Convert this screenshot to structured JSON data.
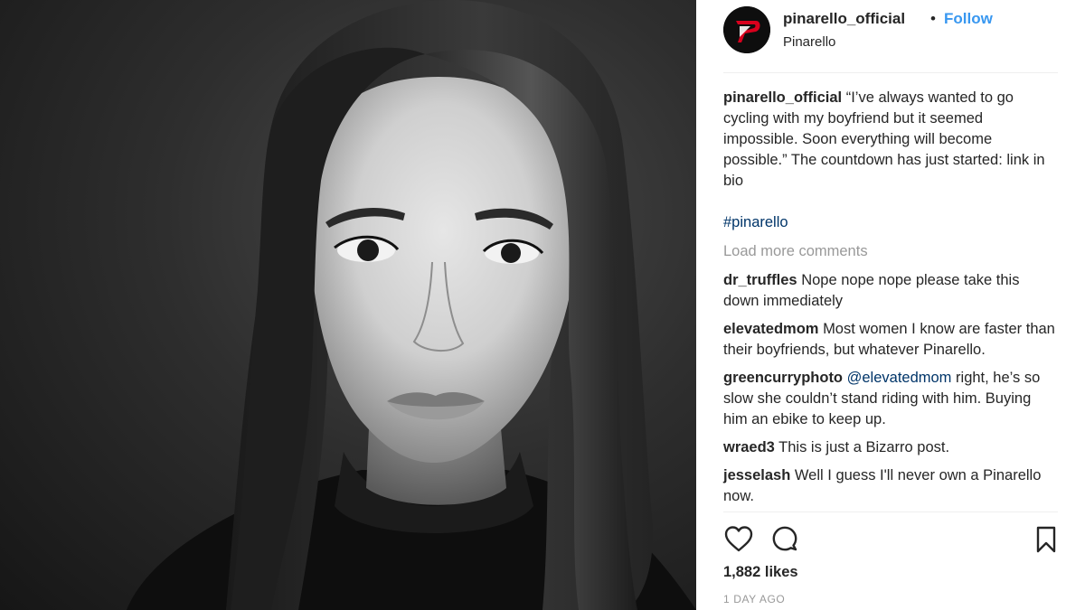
{
  "post": {
    "image_description_icon": "portrait-photo",
    "header": {
      "username": "pinarello_official",
      "separator": "•",
      "follow_label": "Follow",
      "subtitle": "Pinarello",
      "avatar_icon": "pinarello-logo-icon",
      "brand_color": "#d8001d"
    },
    "caption": {
      "user": "pinarello_official",
      "text": "“I’ve always wanted to go cycling with my boyfriend but it seemed impossible. Soon everything will become possible.” The countdown has just started: link in bio",
      "hashtag": "#pinarello"
    },
    "load_more_label": "Load more comments",
    "comments": [
      {
        "user": "dr_truffles",
        "mention": "",
        "text": "Nope nope nope please take this down immediately"
      },
      {
        "user": "elevatedmom",
        "mention": "",
        "text": "Most women I know are faster than their boyfriends, but whatever Pinarello."
      },
      {
        "user": "greencurryphoto",
        "mention": "@elevatedmom",
        "text": "right, he’s so slow she couldn’t stand riding with him. Buying him an ebike to keep up."
      },
      {
        "user": "wraed3",
        "mention": "",
        "text": "This is just a Bizarro post."
      },
      {
        "user": "jesselash",
        "mention": "",
        "text": "Well I guess I'll never own a Pinarello now."
      }
    ],
    "actions": {
      "like_icon": "heart-icon",
      "comment_icon": "speech-bubble-icon",
      "save_icon": "bookmark-icon"
    },
    "likes": "1,882 likes",
    "timestamp": "1 DAY AGO",
    "colors": {
      "link": "#3897f0",
      "hashtag": "#003569",
      "muted": "#999999",
      "text": "#262626"
    }
  }
}
